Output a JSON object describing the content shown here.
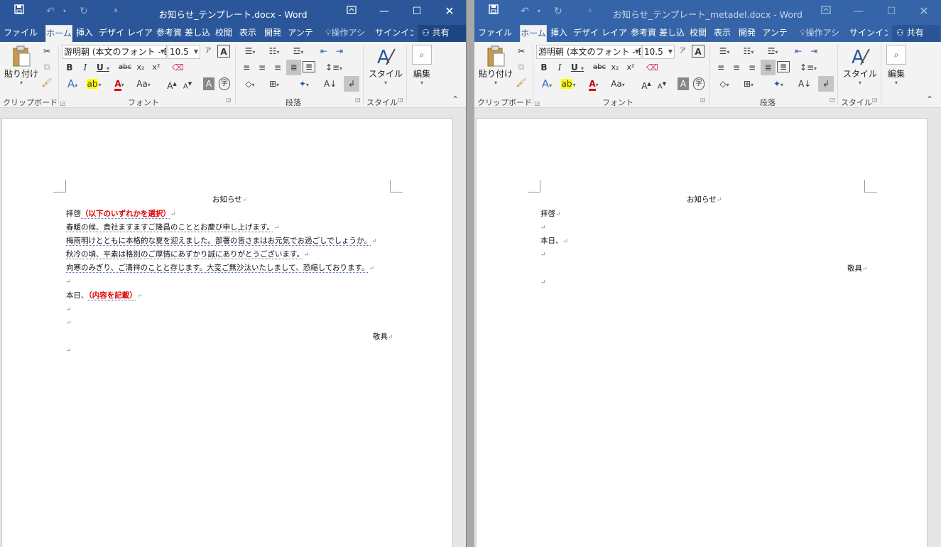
{
  "left_window": {
    "title": "お知らせ_テンプレート.docx - Word",
    "tabs": [
      "ファイル",
      "ホーム",
      "挿入",
      "デザイン",
      "レイアウト",
      "参考資料",
      "差し込み",
      "校閲",
      "表示",
      "開発",
      "アンテナ"
    ],
    "tabs_display": [
      "ファイル",
      "ホーム",
      "挿入",
      "デザイ",
      "レイア",
      "参考資",
      "差し込",
      "校閲",
      "表示",
      "開発",
      "アンテ"
    ],
    "tell_me": "操作アシ",
    "signin": "サインイン",
    "share": "共有",
    "ribbon": {
      "paste_label": "貼り付け",
      "font_name": "游明朝 (本文のフォント - E",
      "font_size": "10.5",
      "styles_label": "スタイル",
      "edit_label": "編集",
      "group_clipboard": "クリップボード",
      "group_font": "フォント",
      "group_paragraph": "段落",
      "group_styles": "スタイル"
    },
    "doc": {
      "title": "お知らせ",
      "salutation": "拝啓",
      "select_note": "（以下のいずれかを選択）",
      "lines": [
        "春暖の候、貴社ますますご隆昌のこととお慶び申し上げます。",
        "梅雨明けとともに本格的な夏を迎えました。部署の皆さまはお元気でお過ごしでしょうか。",
        "秋冷の頃、平素は格別のご厚情にあずかり誠にありがとうございます。",
        "向寒のみぎり、ご清祥のことと存じます。大変ご無沙汰いたしまして、恐縮しております。"
      ],
      "today_prefix": "本日、",
      "content_note": "（内容を記載）",
      "closing": "敬具"
    }
  },
  "right_window": {
    "title": "お知らせ_テンプレート_metadel.docx - Word",
    "tabs_display": [
      "ファイル",
      "ホーム",
      "挿入",
      "デザイ",
      "レイア",
      "参考資",
      "差し込",
      "校閲",
      "表示",
      "開発",
      "アンテ"
    ],
    "tell_me": "操作アシ",
    "signin": "サインイン",
    "share": "共有",
    "ribbon": {
      "paste_label": "貼り付け",
      "font_name": "游明朝 (本文のフォント - E",
      "font_size": "10.5",
      "styles_label": "スタイル",
      "edit_label": "編集",
      "group_clipboard": "クリップボード",
      "group_font": "フォント",
      "group_paragraph": "段落",
      "group_styles": "スタイル"
    },
    "doc": {
      "title": "お知らせ",
      "salutation": "拝啓",
      "today_prefix": "本日、",
      "closing": "敬具"
    }
  },
  "paragraph_mark": "↵",
  "colors": {
    "titlebar_active": "#2b579a",
    "titlebar_inactive": "#3565a8",
    "ribbon_bg": "#f3f3f3",
    "note_red": "#e00000"
  }
}
